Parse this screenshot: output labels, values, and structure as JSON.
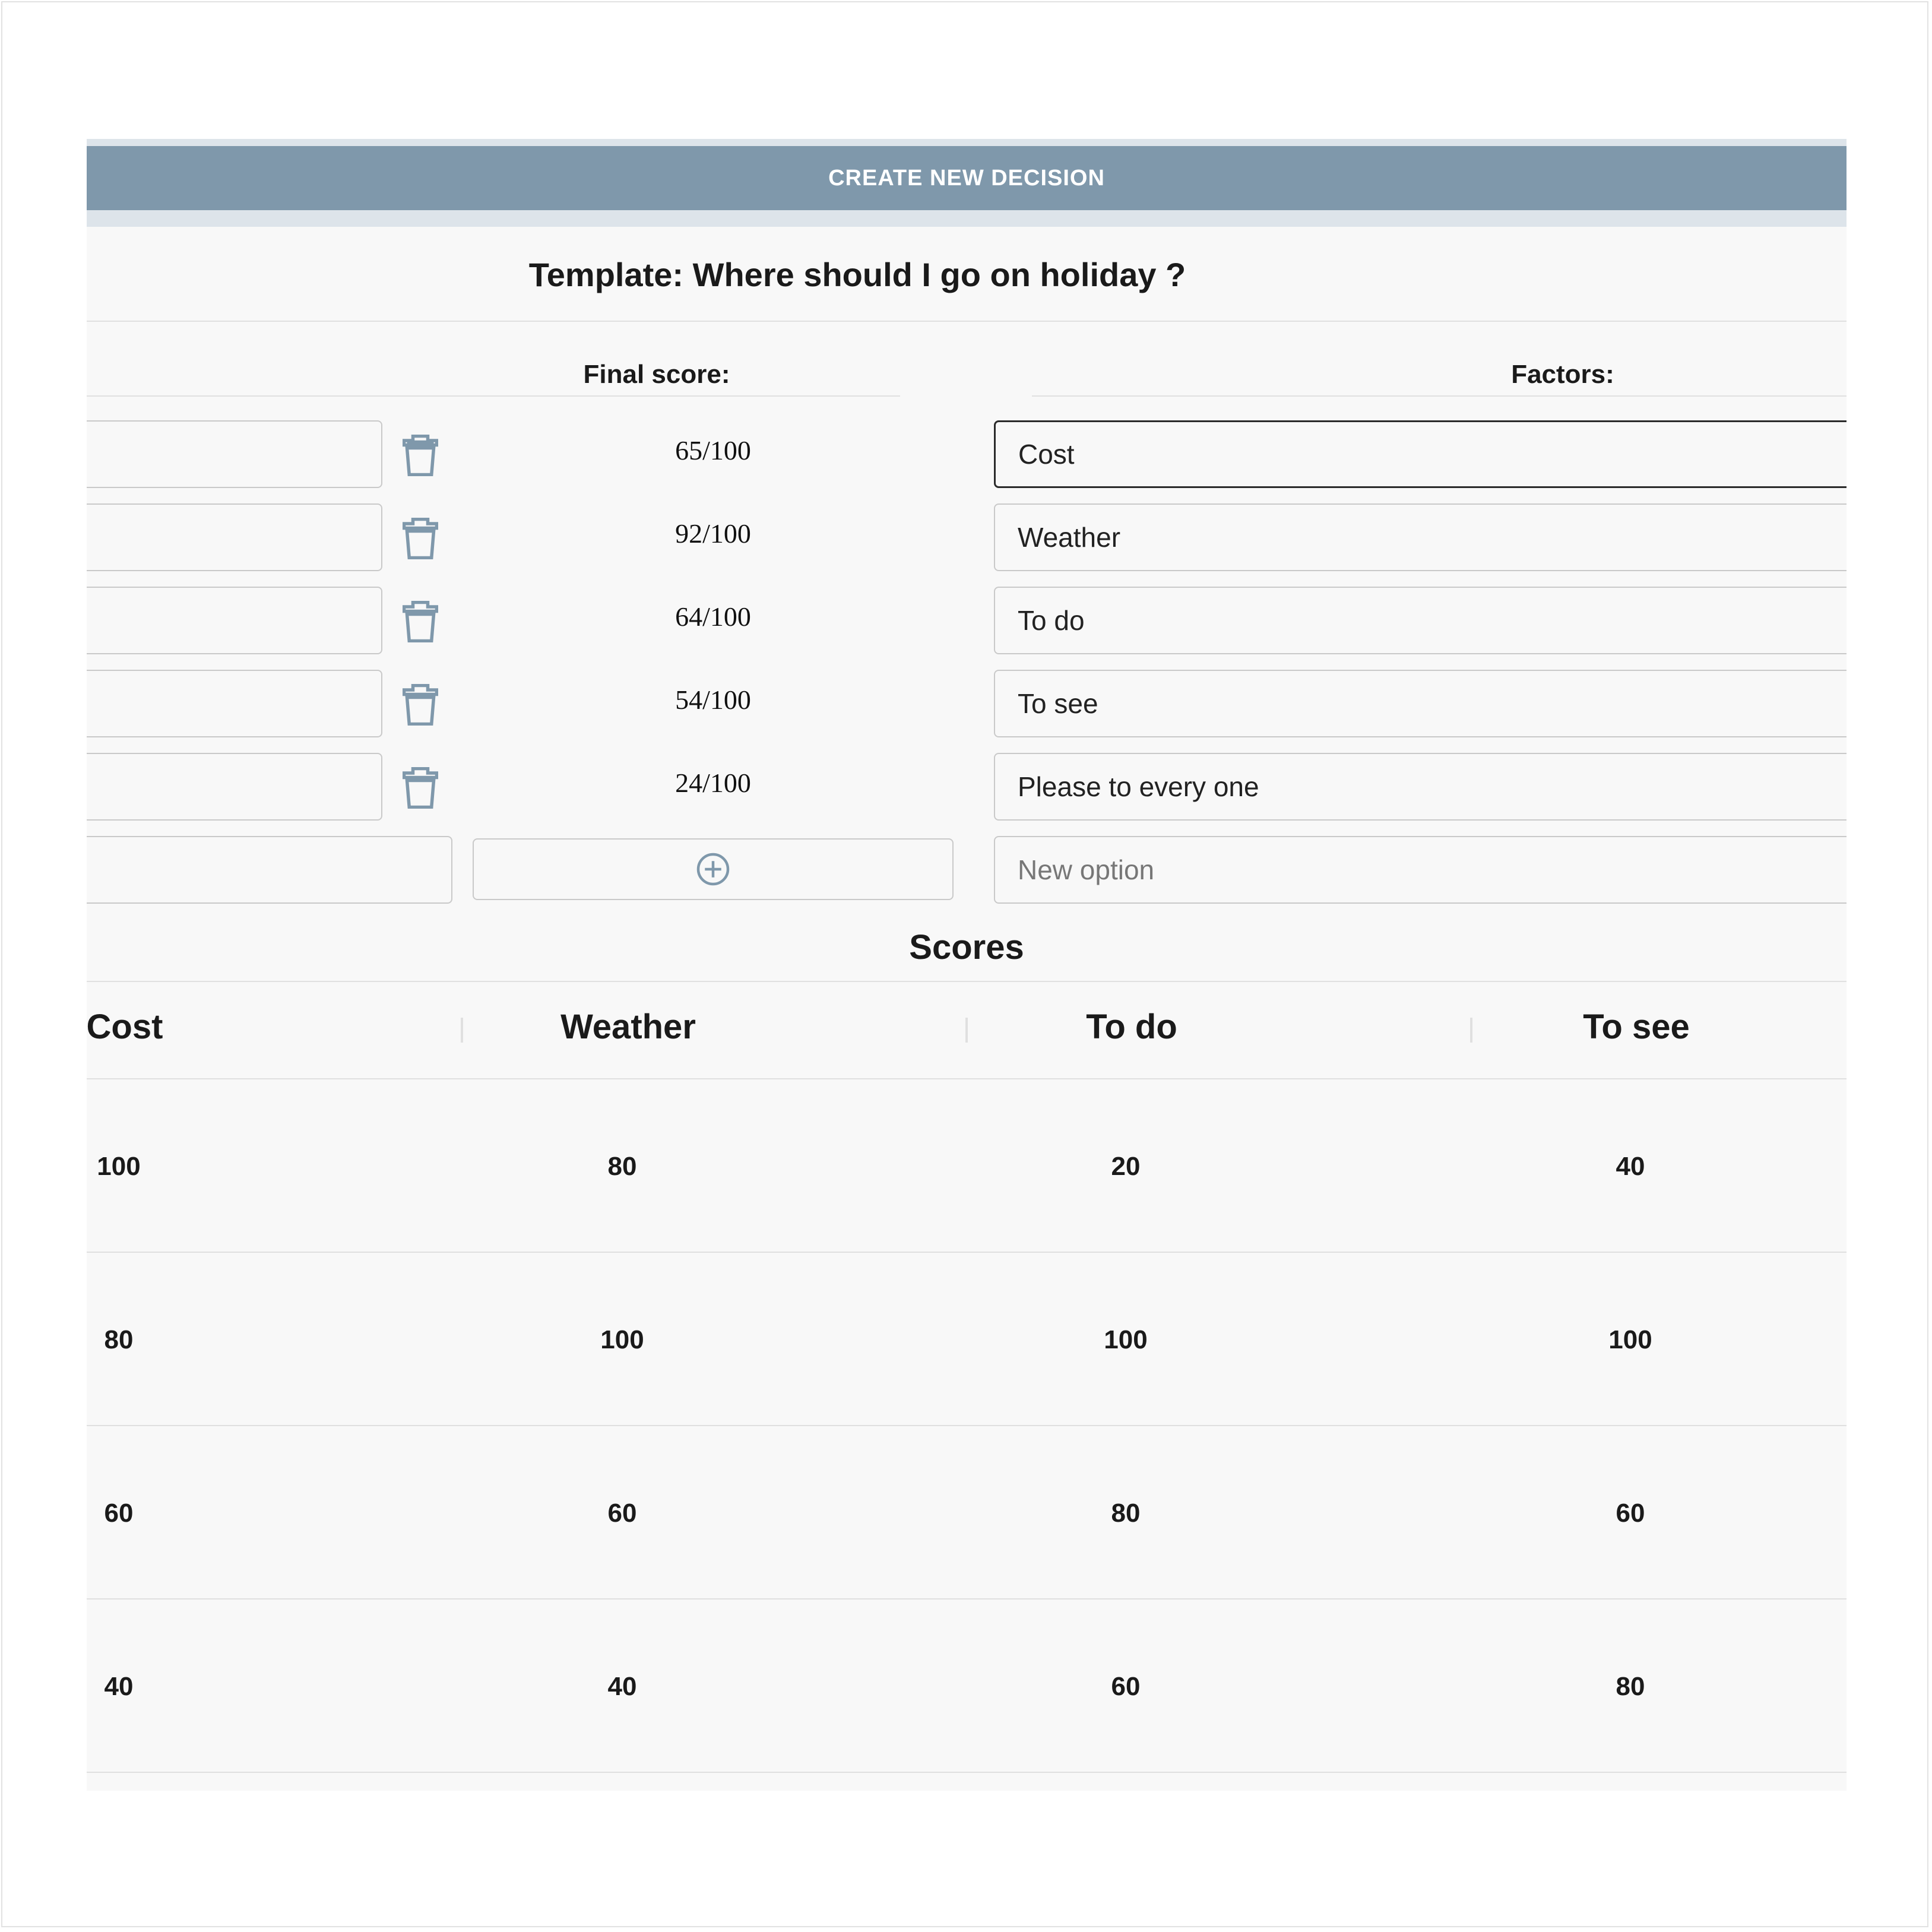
{
  "header": {
    "create_label": "CREATE NEW DECISION"
  },
  "template": {
    "title": "Template: Where should I go on holiday ?"
  },
  "columns": {
    "final_score_label": "Final score:",
    "factors_label": "Factors:"
  },
  "options": [
    {
      "name": "",
      "score": "65/100"
    },
    {
      "name": "",
      "score": "92/100"
    },
    {
      "name": "",
      "score": "64/100"
    },
    {
      "name": "",
      "score": "54/100"
    },
    {
      "name": "",
      "score": "24/100"
    }
  ],
  "factors": [
    "Cost",
    "Weather",
    "To do",
    "To see",
    "Please to every one"
  ],
  "new_option": {
    "placeholder": "New option",
    "value": ""
  },
  "scores_section": {
    "title": "Scores",
    "headers": [
      "Cost",
      "Weather",
      "To do",
      "To see"
    ],
    "rows": [
      [
        "100",
        "80",
        "20",
        "40"
      ],
      [
        "80",
        "100",
        "100",
        "100"
      ],
      [
        "60",
        "60",
        "80",
        "60"
      ],
      [
        "40",
        "40",
        "60",
        "80"
      ]
    ]
  },
  "icons": {
    "delete": "trash-icon",
    "add": "plus-circle-icon"
  },
  "colors": {
    "header_bg": "#7f98ab",
    "panel_bg": "#f8f8f8",
    "icon": "#7f98ab"
  }
}
